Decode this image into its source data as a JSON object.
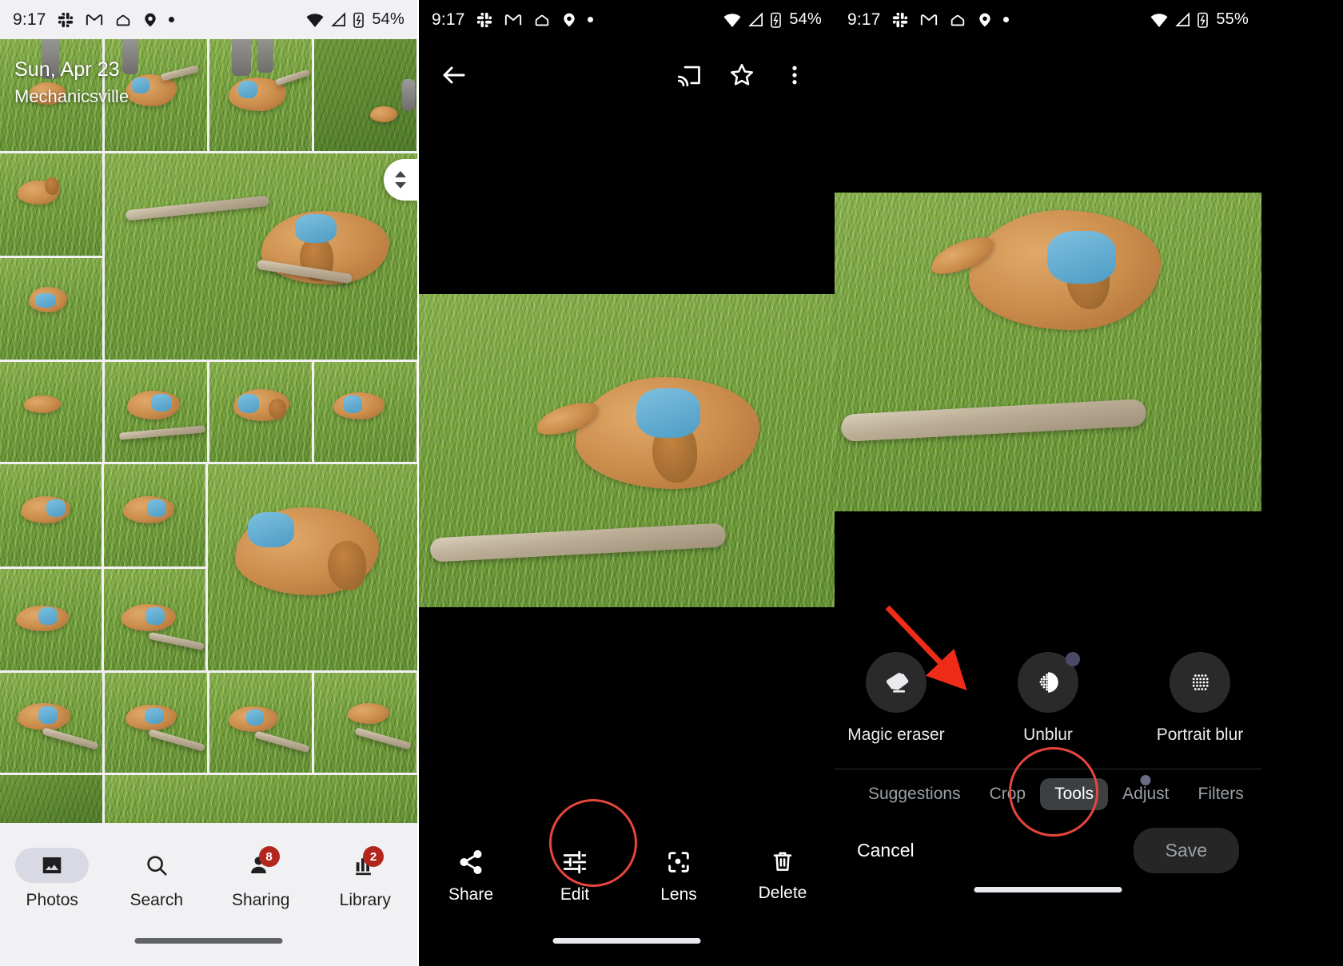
{
  "app": {
    "name": "Google Photos",
    "theme_accent": "#b3261e",
    "annotation_color": "#e8453c"
  },
  "panels": [
    {
      "id": "photos-grid",
      "status_bar": {
        "time": "9:17",
        "icons": [
          "slack-icon",
          "gmail-icon",
          "home-icon",
          "maps-pin-icon",
          "overflow-dot-icon"
        ],
        "right_icons": [
          "wifi-icon",
          "signal-icon",
          "battery-icon"
        ],
        "battery": "54%"
      },
      "banner": {
        "date": "Sun, Apr 23",
        "location": "Mechanicsville"
      },
      "scroll_fab": {
        "up": "scroll-up-chevron",
        "down": "scroll-down-chevron"
      },
      "bottom_nav": [
        {
          "label": "Photos",
          "icon": "photos-icon",
          "active": true,
          "badge": ""
        },
        {
          "label": "Search",
          "icon": "search-icon",
          "active": false,
          "badge": ""
        },
        {
          "label": "Sharing",
          "icon": "sharing-icon",
          "active": false,
          "badge": "8"
        },
        {
          "label": "Library",
          "icon": "library-icon",
          "active": false,
          "badge": "2"
        }
      ]
    },
    {
      "id": "photo-viewer",
      "status_bar": {
        "time": "9:17",
        "icons": [
          "slack-icon",
          "gmail-icon",
          "home-icon",
          "maps-pin-icon",
          "overflow-dot-icon"
        ],
        "right_icons": [
          "wifi-icon",
          "signal-icon",
          "battery-icon"
        ],
        "battery": "54%"
      },
      "top_bar": {
        "back": "back-arrow-icon",
        "cast": "cast-icon",
        "favorite": "star-icon",
        "more": "more-vert-icon"
      },
      "actions": [
        {
          "label": "Share",
          "icon": "share-icon",
          "highlighted": false
        },
        {
          "label": "Edit",
          "icon": "edit-sliders-icon",
          "highlighted": true
        },
        {
          "label": "Lens",
          "icon": "lens-icon",
          "highlighted": false
        },
        {
          "label": "Delete",
          "icon": "trash-icon",
          "highlighted": false
        }
      ]
    },
    {
      "id": "photo-editor",
      "status_bar": {
        "time": "9:17",
        "icons": [
          "slack-icon",
          "gmail-icon",
          "home-icon",
          "maps-pin-icon",
          "overflow-dot-icon"
        ],
        "right_icons": [
          "wifi-icon",
          "signal-icon",
          "battery-icon"
        ],
        "battery": "55%"
      },
      "tools": [
        {
          "label": "Magic eraser",
          "icon": "eraser-icon",
          "new_dot": false
        },
        {
          "label": "Unblur",
          "icon": "unblur-icon",
          "new_dot": true
        },
        {
          "label": "Portrait blur",
          "icon": "portrait-blur-icon",
          "new_dot": false
        }
      ],
      "tabs": [
        {
          "label": "Suggestions",
          "active": false,
          "new_dot": false
        },
        {
          "label": "Crop",
          "active": false,
          "new_dot": false
        },
        {
          "label": "Tools",
          "active": true,
          "new_dot": false
        },
        {
          "label": "Adjust",
          "active": false,
          "new_dot": true
        },
        {
          "label": "Filters",
          "active": false,
          "new_dot": false
        }
      ],
      "footer": {
        "cancel": "Cancel",
        "save": "Save"
      },
      "annotation": {
        "type": "arrow",
        "points_to": "Magic eraser"
      }
    }
  ]
}
